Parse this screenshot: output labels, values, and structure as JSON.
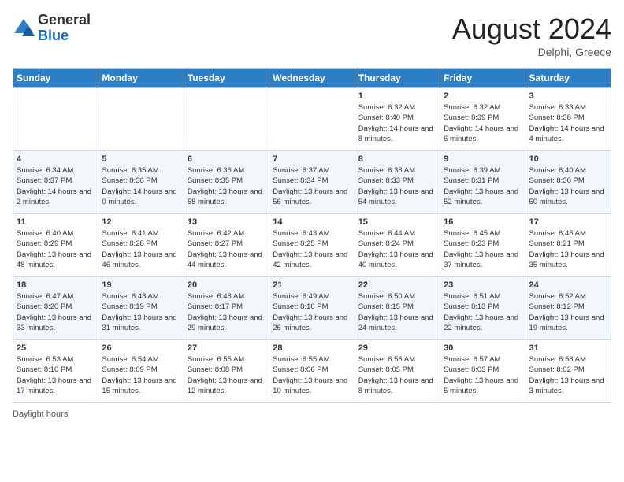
{
  "header": {
    "logo_general": "General",
    "logo_blue": "Blue",
    "month_year": "August 2024",
    "location": "Delphi, Greece"
  },
  "days_of_week": [
    "Sunday",
    "Monday",
    "Tuesday",
    "Wednesday",
    "Thursday",
    "Friday",
    "Saturday"
  ],
  "weeks": [
    [
      {
        "day": "",
        "sunrise": "",
        "sunset": "",
        "daylight": ""
      },
      {
        "day": "",
        "sunrise": "",
        "sunset": "",
        "daylight": ""
      },
      {
        "day": "",
        "sunrise": "",
        "sunset": "",
        "daylight": ""
      },
      {
        "day": "",
        "sunrise": "",
        "sunset": "",
        "daylight": ""
      },
      {
        "day": "1",
        "sunrise": "Sunrise: 6:32 AM",
        "sunset": "Sunset: 8:40 PM",
        "daylight": "Daylight: 14 hours and 8 minutes."
      },
      {
        "day": "2",
        "sunrise": "Sunrise: 6:32 AM",
        "sunset": "Sunset: 8:39 PM",
        "daylight": "Daylight: 14 hours and 6 minutes."
      },
      {
        "day": "3",
        "sunrise": "Sunrise: 6:33 AM",
        "sunset": "Sunset: 8:38 PM",
        "daylight": "Daylight: 14 hours and 4 minutes."
      }
    ],
    [
      {
        "day": "4",
        "sunrise": "Sunrise: 6:34 AM",
        "sunset": "Sunset: 8:37 PM",
        "daylight": "Daylight: 14 hours and 2 minutes."
      },
      {
        "day": "5",
        "sunrise": "Sunrise: 6:35 AM",
        "sunset": "Sunset: 8:36 PM",
        "daylight": "Daylight: 14 hours and 0 minutes."
      },
      {
        "day": "6",
        "sunrise": "Sunrise: 6:36 AM",
        "sunset": "Sunset: 8:35 PM",
        "daylight": "Daylight: 13 hours and 58 minutes."
      },
      {
        "day": "7",
        "sunrise": "Sunrise: 6:37 AM",
        "sunset": "Sunset: 8:34 PM",
        "daylight": "Daylight: 13 hours and 56 minutes."
      },
      {
        "day": "8",
        "sunrise": "Sunrise: 6:38 AM",
        "sunset": "Sunset: 8:33 PM",
        "daylight": "Daylight: 13 hours and 54 minutes."
      },
      {
        "day": "9",
        "sunrise": "Sunrise: 6:39 AM",
        "sunset": "Sunset: 8:31 PM",
        "daylight": "Daylight: 13 hours and 52 minutes."
      },
      {
        "day": "10",
        "sunrise": "Sunrise: 6:40 AM",
        "sunset": "Sunset: 8:30 PM",
        "daylight": "Daylight: 13 hours and 50 minutes."
      }
    ],
    [
      {
        "day": "11",
        "sunrise": "Sunrise: 6:40 AM",
        "sunset": "Sunset: 8:29 PM",
        "daylight": "Daylight: 13 hours and 48 minutes."
      },
      {
        "day": "12",
        "sunrise": "Sunrise: 6:41 AM",
        "sunset": "Sunset: 8:28 PM",
        "daylight": "Daylight: 13 hours and 46 minutes."
      },
      {
        "day": "13",
        "sunrise": "Sunrise: 6:42 AM",
        "sunset": "Sunset: 8:27 PM",
        "daylight": "Daylight: 13 hours and 44 minutes."
      },
      {
        "day": "14",
        "sunrise": "Sunrise: 6:43 AM",
        "sunset": "Sunset: 8:25 PM",
        "daylight": "Daylight: 13 hours and 42 minutes."
      },
      {
        "day": "15",
        "sunrise": "Sunrise: 6:44 AM",
        "sunset": "Sunset: 8:24 PM",
        "daylight": "Daylight: 13 hours and 40 minutes."
      },
      {
        "day": "16",
        "sunrise": "Sunrise: 6:45 AM",
        "sunset": "Sunset: 8:23 PM",
        "daylight": "Daylight: 13 hours and 37 minutes."
      },
      {
        "day": "17",
        "sunrise": "Sunrise: 6:46 AM",
        "sunset": "Sunset: 8:21 PM",
        "daylight": "Daylight: 13 hours and 35 minutes."
      }
    ],
    [
      {
        "day": "18",
        "sunrise": "Sunrise: 6:47 AM",
        "sunset": "Sunset: 8:20 PM",
        "daylight": "Daylight: 13 hours and 33 minutes."
      },
      {
        "day": "19",
        "sunrise": "Sunrise: 6:48 AM",
        "sunset": "Sunset: 8:19 PM",
        "daylight": "Daylight: 13 hours and 31 minutes."
      },
      {
        "day": "20",
        "sunrise": "Sunrise: 6:48 AM",
        "sunset": "Sunset: 8:17 PM",
        "daylight": "Daylight: 13 hours and 29 minutes."
      },
      {
        "day": "21",
        "sunrise": "Sunrise: 6:49 AM",
        "sunset": "Sunset: 8:16 PM",
        "daylight": "Daylight: 13 hours and 26 minutes."
      },
      {
        "day": "22",
        "sunrise": "Sunrise: 6:50 AM",
        "sunset": "Sunset: 8:15 PM",
        "daylight": "Daylight: 13 hours and 24 minutes."
      },
      {
        "day": "23",
        "sunrise": "Sunrise: 6:51 AM",
        "sunset": "Sunset: 8:13 PM",
        "daylight": "Daylight: 13 hours and 22 minutes."
      },
      {
        "day": "24",
        "sunrise": "Sunrise: 6:52 AM",
        "sunset": "Sunset: 8:12 PM",
        "daylight": "Daylight: 13 hours and 19 minutes."
      }
    ],
    [
      {
        "day": "25",
        "sunrise": "Sunrise: 6:53 AM",
        "sunset": "Sunset: 8:10 PM",
        "daylight": "Daylight: 13 hours and 17 minutes."
      },
      {
        "day": "26",
        "sunrise": "Sunrise: 6:54 AM",
        "sunset": "Sunset: 8:09 PM",
        "daylight": "Daylight: 13 hours and 15 minutes."
      },
      {
        "day": "27",
        "sunrise": "Sunrise: 6:55 AM",
        "sunset": "Sunset: 8:08 PM",
        "daylight": "Daylight: 13 hours and 12 minutes."
      },
      {
        "day": "28",
        "sunrise": "Sunrise: 6:55 AM",
        "sunset": "Sunset: 8:06 PM",
        "daylight": "Daylight: 13 hours and 10 minutes."
      },
      {
        "day": "29",
        "sunrise": "Sunrise: 6:56 AM",
        "sunset": "Sunset: 8:05 PM",
        "daylight": "Daylight: 13 hours and 8 minutes."
      },
      {
        "day": "30",
        "sunrise": "Sunrise: 6:57 AM",
        "sunset": "Sunset: 8:03 PM",
        "daylight": "Daylight: 13 hours and 5 minutes."
      },
      {
        "day": "31",
        "sunrise": "Sunrise: 6:58 AM",
        "sunset": "Sunset: 8:02 PM",
        "daylight": "Daylight: 13 hours and 3 minutes."
      }
    ]
  ],
  "footer": {
    "daylight_hours_label": "Daylight hours"
  }
}
